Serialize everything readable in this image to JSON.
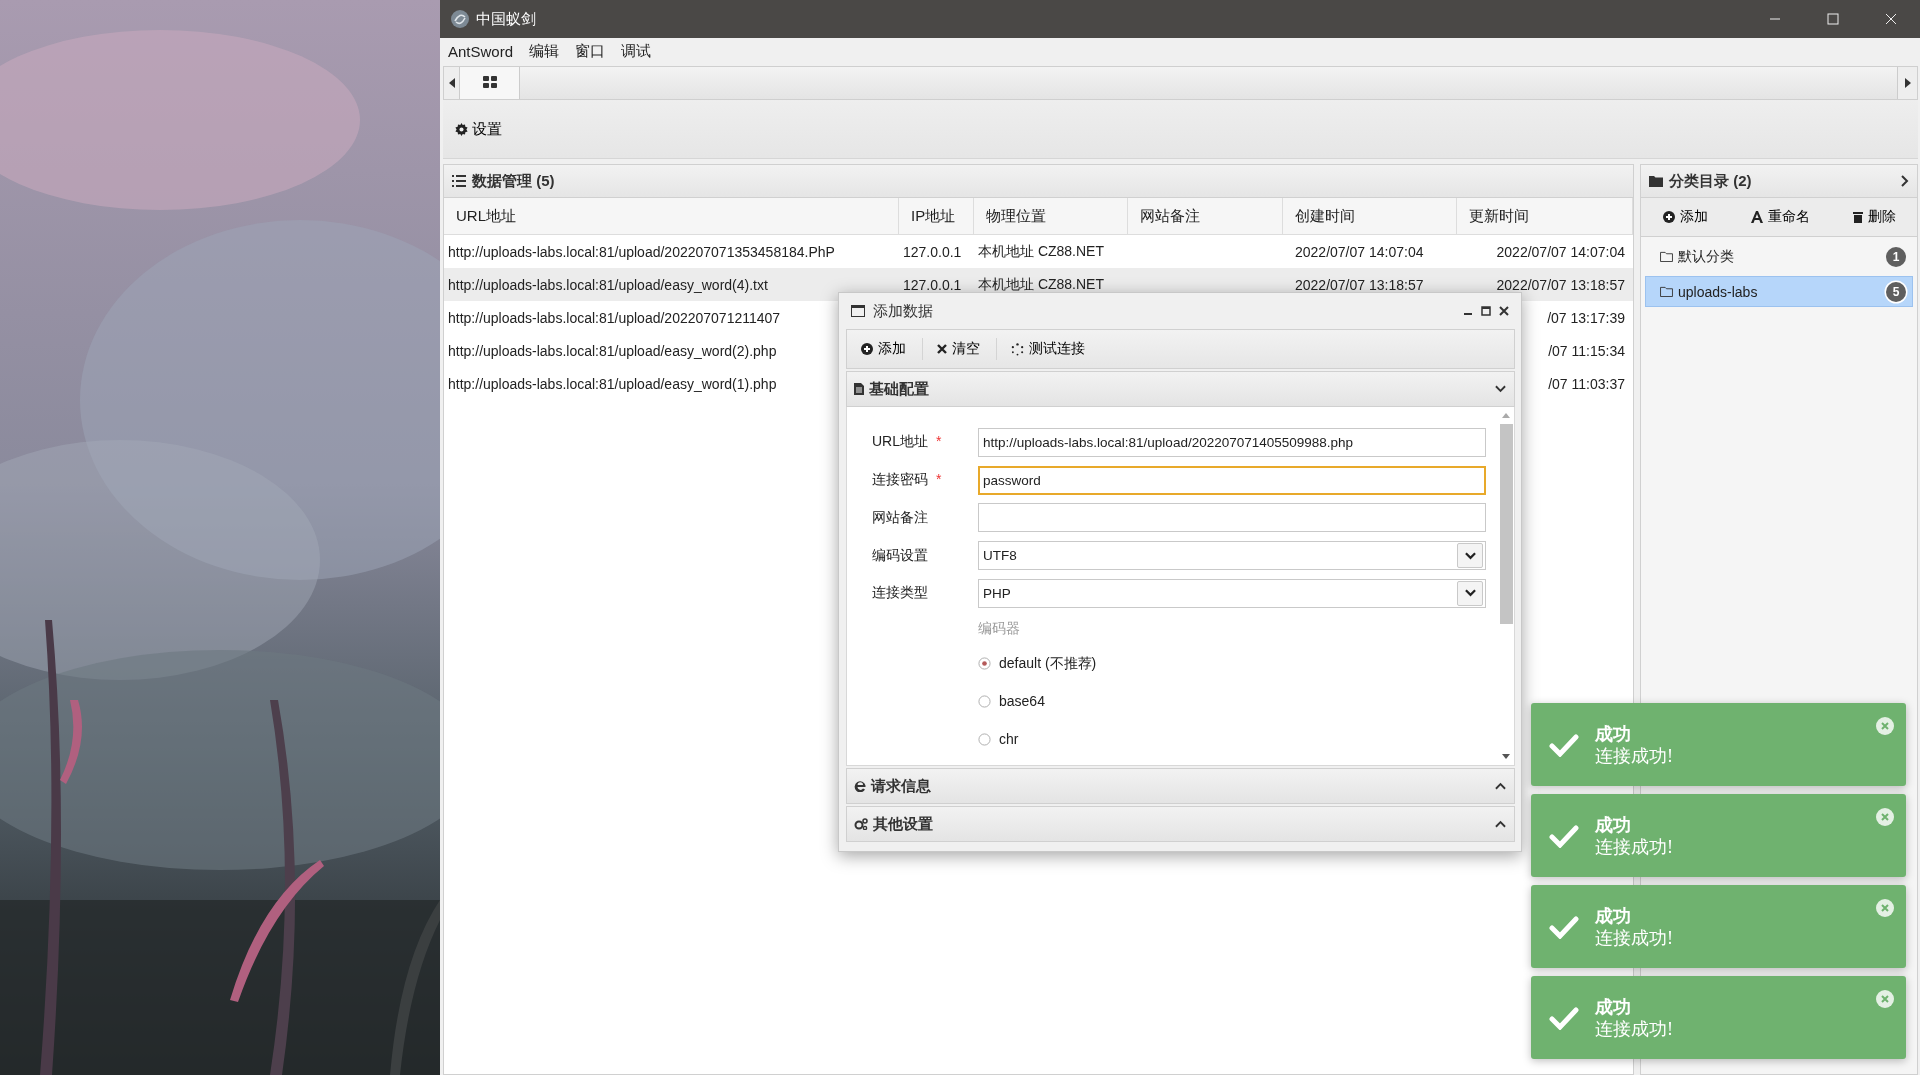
{
  "window": {
    "title": "中国蚁剑"
  },
  "menu": [
    "AntSword",
    "编辑",
    "窗口",
    "调试"
  ],
  "tabs": [
    {
      "kind": "grid",
      "selected": true
    }
  ],
  "toolbar": {
    "settings": "设置"
  },
  "data_panel": {
    "title": "数据管理 (5)",
    "columns": [
      "URL地址",
      "IP地址",
      "物理位置",
      "网站备注",
      "创建时间",
      "更新时间"
    ],
    "rows": [
      {
        "url": "http://uploads-labs.local:81/upload/202207071353458184.PhP",
        "ip": "127.0.0.1",
        "location": "本机地址 CZ88.NET",
        "created": "2022/07/07 14:07:04",
        "updated": "2022/07/07 14:07:04",
        "selected": false
      },
      {
        "url": "http://uploads-labs.local:81/upload/easy_word(4).txt",
        "ip": "127.0.0.1",
        "location": "本机地址 CZ88.NET",
        "created": "2022/07/07 13:18:57",
        "updated": "2022/07/07 13:18:57",
        "selected": true
      },
      {
        "url": "http://uploads-labs.local:81/upload/202207071211407",
        "updated": "/07 13:17:39",
        "selected": false
      },
      {
        "url": "http://uploads-labs.local:81/upload/easy_word(2).php",
        "updated": "/07 11:15:34",
        "selected": false
      },
      {
        "url": "http://uploads-labs.local:81/upload/easy_word(1).php",
        "updated": "/07 11:03:37",
        "selected": false
      }
    ]
  },
  "category_panel": {
    "title": "分类目录 (2)",
    "actions": [
      {
        "kind": "add",
        "label": "添加"
      },
      {
        "kind": "rename",
        "label": "重命名"
      },
      {
        "kind": "delete",
        "label": "删除"
      }
    ],
    "items": [
      {
        "label": "默认分类",
        "count": "1",
        "selected": false
      },
      {
        "label": "uploads-labs",
        "count": "5",
        "selected": true
      }
    ]
  },
  "dialog": {
    "title": "添加数据",
    "toolbar": [
      {
        "kind": "add",
        "label": "添加"
      },
      {
        "kind": "clear",
        "label": "清空"
      },
      {
        "kind": "test",
        "label": "测试连接"
      }
    ],
    "sections": [
      {
        "kind": "basic",
        "title": "基础配置",
        "expanded": true
      },
      {
        "kind": "request",
        "title": "请求信息",
        "expanded": false
      },
      {
        "kind": "other",
        "title": "其他设置",
        "expanded": false
      }
    ],
    "fields": [
      {
        "label": "URL地址",
        "marker": "*",
        "kind": "text",
        "value": "http://uploads-labs.local:81/upload/202207071405509988.php",
        "focused": false
      },
      {
        "label": "连接密码",
        "marker": "*",
        "kind": "text",
        "value": "password",
        "focused": true
      },
      {
        "label": "网站备注",
        "kind": "text",
        "focused": false
      },
      {
        "label": "编码设置",
        "kind": "select",
        "value": "UTF8",
        "focused": false
      },
      {
        "label": "连接类型",
        "kind": "select",
        "value": "PHP",
        "focused": false
      }
    ],
    "encoder": {
      "label": "编码器",
      "options": [
        {
          "label": "default (不推荐)",
          "selected": true
        },
        {
          "label": "base64",
          "selected": false
        },
        {
          "label": "chr",
          "selected": false
        }
      ]
    }
  },
  "notifications": [
    {
      "title": "成功",
      "message": "连接成功!"
    },
    {
      "title": "成功",
      "message": "连接成功!"
    },
    {
      "title": "成功",
      "message": "连接成功!"
    },
    {
      "title": "成功",
      "message": "连接成功!"
    }
  ]
}
